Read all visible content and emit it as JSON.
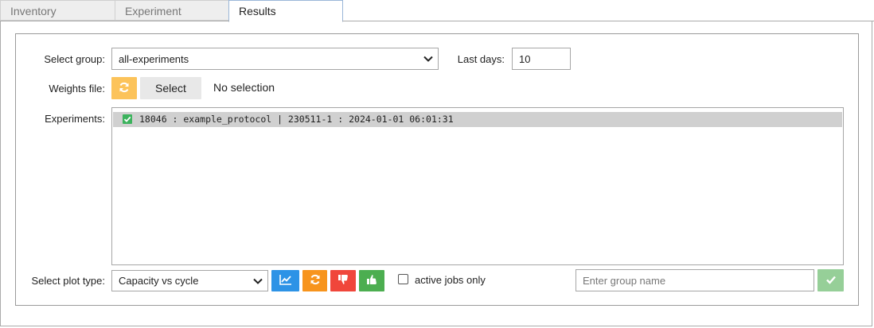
{
  "tabs": [
    {
      "label": "Inventory",
      "active": false
    },
    {
      "label": "Experiment",
      "active": false
    },
    {
      "label": "Results",
      "active": true
    }
  ],
  "form": {
    "select_group_label": "Select group:",
    "select_group_value": "all-experiments",
    "last_days_label": "Last days:",
    "last_days_value": "10",
    "weights_file_label": "Weights file:",
    "weights_select_label": "Select",
    "weights_status": "No selection",
    "experiments_label": "Experiments:",
    "experiments": [
      {
        "text": "18046 : example_protocol | 230511-1 : 2024-01-01 06:01:31",
        "checked": true
      }
    ]
  },
  "bottom": {
    "plot_type_label": "Select plot type:",
    "plot_type_value": "Capacity vs cycle",
    "active_jobs_label": "active jobs only",
    "active_jobs_checked": false,
    "group_name_placeholder": "Enter group name"
  },
  "colors": {
    "refresh_light": "#fcc35a",
    "chart_button": "#2d93e6",
    "refresh_orange": "#f7941d",
    "dislike_red": "#f0463b",
    "like_green": "#4cae50",
    "confirm_green_disabled": "#96cf98",
    "checkbox_green": "#3cb35d"
  },
  "icons": {
    "refresh": "refresh-icon",
    "chart": "line-chart-icon",
    "dislike": "thumbs-down-icon",
    "like": "thumbs-up-icon",
    "confirm": "checkmark-icon",
    "dropdown": "chevron-down-icon"
  }
}
